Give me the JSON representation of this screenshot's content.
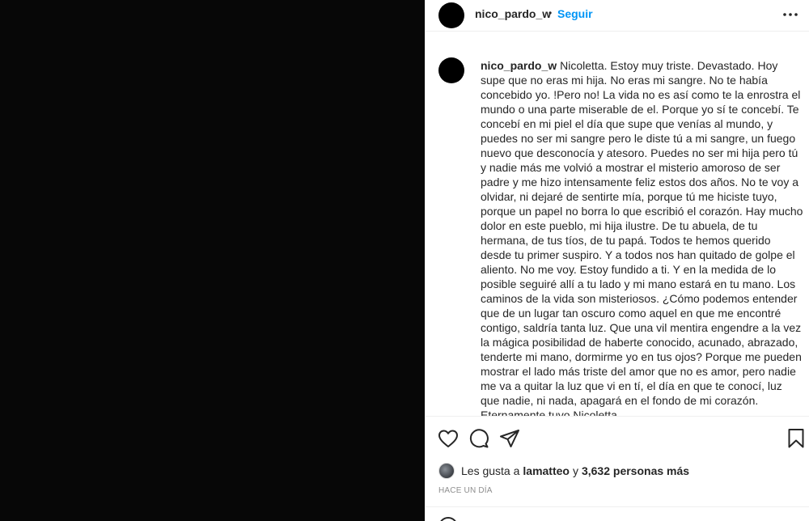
{
  "post": {
    "username": "nico_pardo_w",
    "separator": "•",
    "follow_label": "Seguir",
    "caption_user": "nico_pardo_w",
    "caption_text": "Nicoletta. Estoy muy triste. Devastado. Hoy supe que no eras mi hija. No eras mi sangre. No te había concebido yo. !Pero no! La vida no es así como te la enrostra el mundo o una parte miserable de el. Porque yo sí te concebí. Te concebí en mi piel el día que supe que venías al mundo, y puedes no ser mi sangre pero le diste tú a mi sangre, un fuego nuevo que desconocía y atesoro. Puedes no ser mi hija pero tú y nadie más me volvió a mostrar el misterio amoroso de ser padre y me hizo intensamente feliz estos dos años. No te voy a olvidar, ni dejaré de sentirte mía, porque tú me hiciste tuyo, porque un papel no borra lo que escribió el corazón. Hay mucho dolor en este pueblo, mi hija ilustre. De tu abuela, de tu hermana, de tus tíos, de tu papá. Todos te hemos querido desde tu primer suspiro. Y a todos nos han quitado de golpe el aliento. No me voy. Estoy fundido a ti. Y en la medida de lo posible seguiré allí a tu lado y mi mano estará en tu mano. Los caminos de la vida son misteriosos. ¿Cómo podemos entender que de un lugar tan oscuro como aquel en que me encontré contigo, saldría tanta luz. Que una vil mentira engendre a la vez la mágica posibilidad de haberte conocido, acunado, abrazado, tenderte mi mano, dormirme yo en tus ojos? Porque me pueden mostrar el lado más triste del amor que no es amor, pero nadie me va a quitar la luz que vi en tí, el día en que te conocí, luz que nadie, ni nada, apagará en el fondo de mi corazón.\nEternamente tuyo Nicoletta.\nGrabado me llevas en tu nombre.\nTatuada te llevaré en mi piel.",
    "likes_prefix": "Les gusta a",
    "likes_user": "lamatteo",
    "likes_mid": "y",
    "likes_count": "3,632 personas más",
    "time_label": "HACE UN DÍA"
  },
  "icons": {
    "more": "more-options-icon",
    "like": "heart-icon",
    "comment": "comment-icon",
    "share": "paper-plane-icon",
    "save": "bookmark-icon",
    "emoji": "emoji-icon"
  },
  "colors": {
    "accent": "#0095f6",
    "text": "#262626",
    "muted": "#8e8e8e",
    "media_bg": "#070707"
  }
}
